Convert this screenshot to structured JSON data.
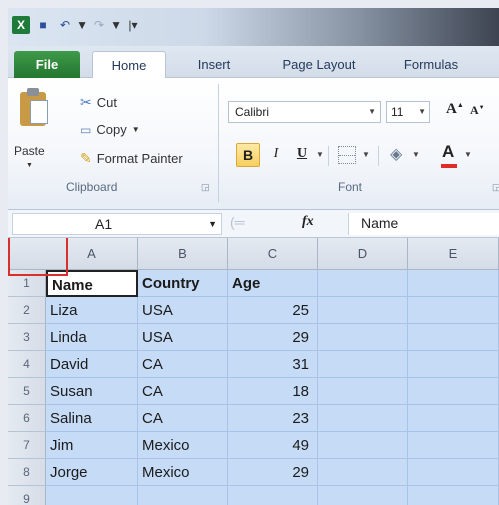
{
  "qat": {
    "app_icon": "excel-logo-icon",
    "save_icon": "save-icon",
    "undo_icon": "undo-icon",
    "redo_icon": "redo-icon"
  },
  "tabs": {
    "file": "File",
    "home": "Home",
    "insert": "Insert",
    "page_layout": "Page Layout",
    "formulas": "Formulas"
  },
  "clipboard": {
    "paste_label": "Paste",
    "cut_label": "Cut",
    "copy_label": "Copy",
    "format_painter_label": "Format Painter",
    "group_label": "Clipboard"
  },
  "font": {
    "font_name": "Calibri",
    "font_size": "11",
    "grow_label": "A",
    "shrink_label": "A",
    "bold_label": "B",
    "italic_label": "I",
    "underline_label": "U",
    "font_color_label": "A",
    "group_label": "Font",
    "font_color_hex": "#e12a2a"
  },
  "formula_bar": {
    "name_box": "A1",
    "fx_label": "fx",
    "formula": "Name"
  },
  "sheet": {
    "columns": [
      "A",
      "B",
      "C",
      "D",
      "E"
    ],
    "rows": [
      {
        "num": "1",
        "name": "Name",
        "country": "Country",
        "age": "Age"
      },
      {
        "num": "2",
        "name": "Liza",
        "country": "USA",
        "age": "25"
      },
      {
        "num": "3",
        "name": "Linda",
        "country": "USA",
        "age": "29"
      },
      {
        "num": "4",
        "name": "David",
        "country": "CA",
        "age": "31"
      },
      {
        "num": "5",
        "name": "Susan",
        "country": "CA",
        "age": "18"
      },
      {
        "num": "6",
        "name": "Salina",
        "country": "CA",
        "age": "23"
      },
      {
        "num": "7",
        "name": "Jim",
        "country": "Mexico",
        "age": "49"
      },
      {
        "num": "8",
        "name": "Jorge",
        "country": "Mexico",
        "age": "29"
      },
      {
        "num": "9",
        "name": "",
        "country": "",
        "age": ""
      }
    ],
    "selection_color": "#c6dbf6",
    "highlight_box_color": "#d8312c"
  }
}
